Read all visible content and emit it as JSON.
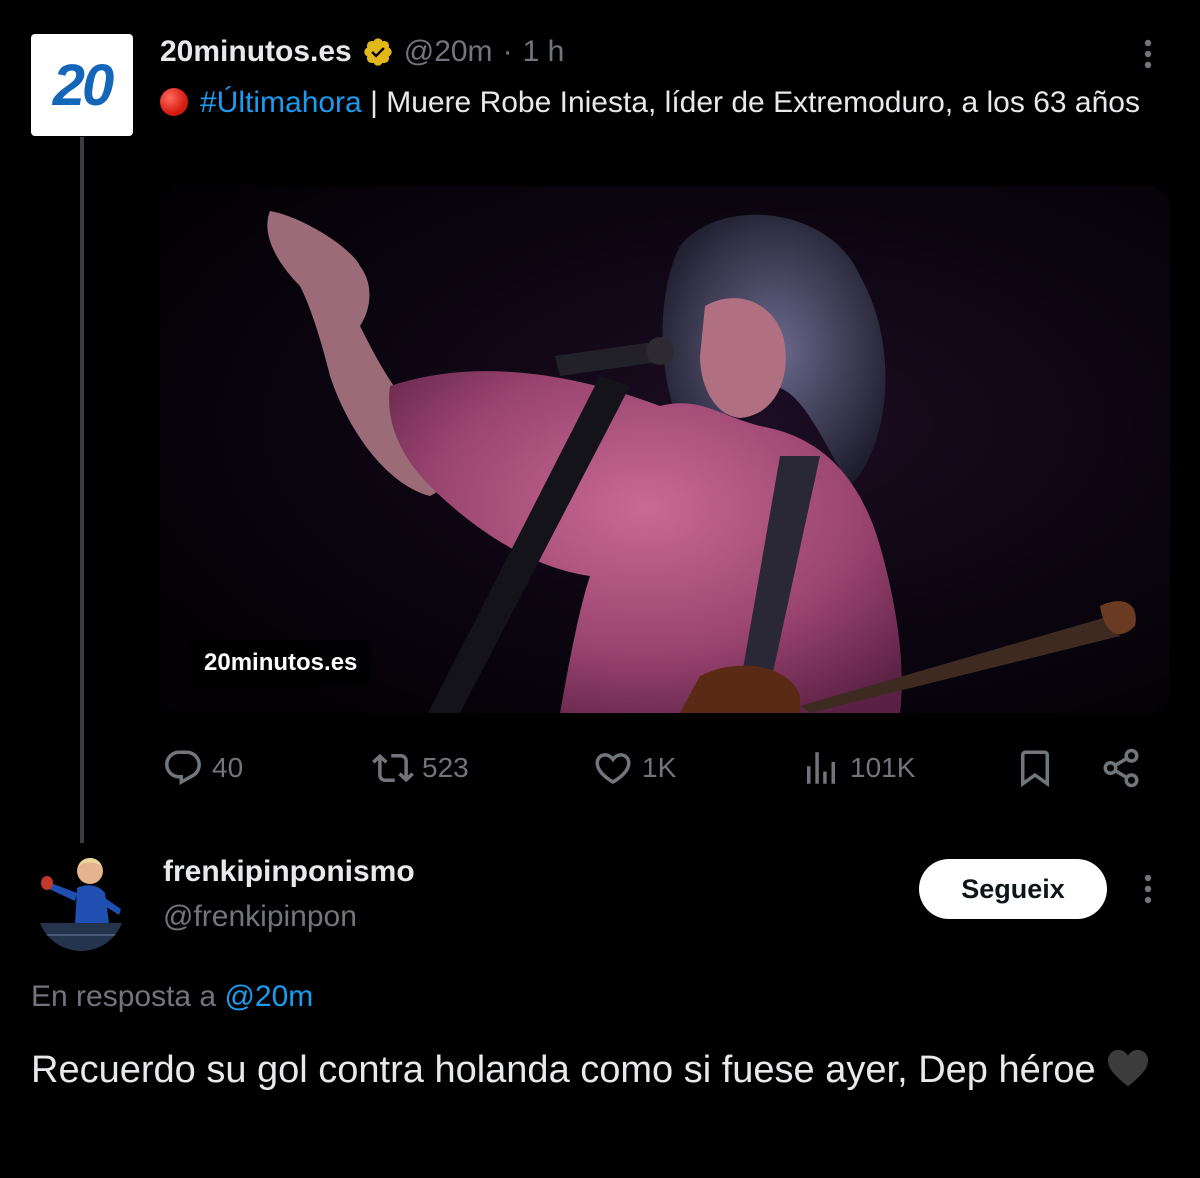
{
  "tweet": {
    "display_name": "20minutos.es",
    "avatar_text": "20",
    "handle": "@20m",
    "separator": "·",
    "time": "1 h",
    "hashtag": "#Últimahora",
    "text": " | Muere Robe Iniesta, líder de Extremoduro, a los 63 años",
    "media_label": "20minutos.es",
    "actions": {
      "replies": "40",
      "reposts": "523",
      "likes": "1K",
      "views": "101K"
    }
  },
  "reply": {
    "display_name": "frenkipinponismo",
    "handle": "@frenkipinpon",
    "follow_label": "Segueix",
    "reply_prefix": "En resposta a ",
    "reply_mention": "@20m",
    "text": "Recuerdo su gol contra holanda como si fuese ayer, Dep héroe"
  },
  "colors": {
    "background": "#000000",
    "link": "#1d9bf0",
    "muted": "#71767b",
    "verified": "#e2b719",
    "brand": "#1366b8"
  },
  "icons": [
    "verified-badge-icon",
    "more-icon",
    "live-dot-icon",
    "reply-icon",
    "repost-icon",
    "like-icon",
    "views-icon",
    "bookmark-icon",
    "share-icon",
    "black-heart-icon"
  ]
}
